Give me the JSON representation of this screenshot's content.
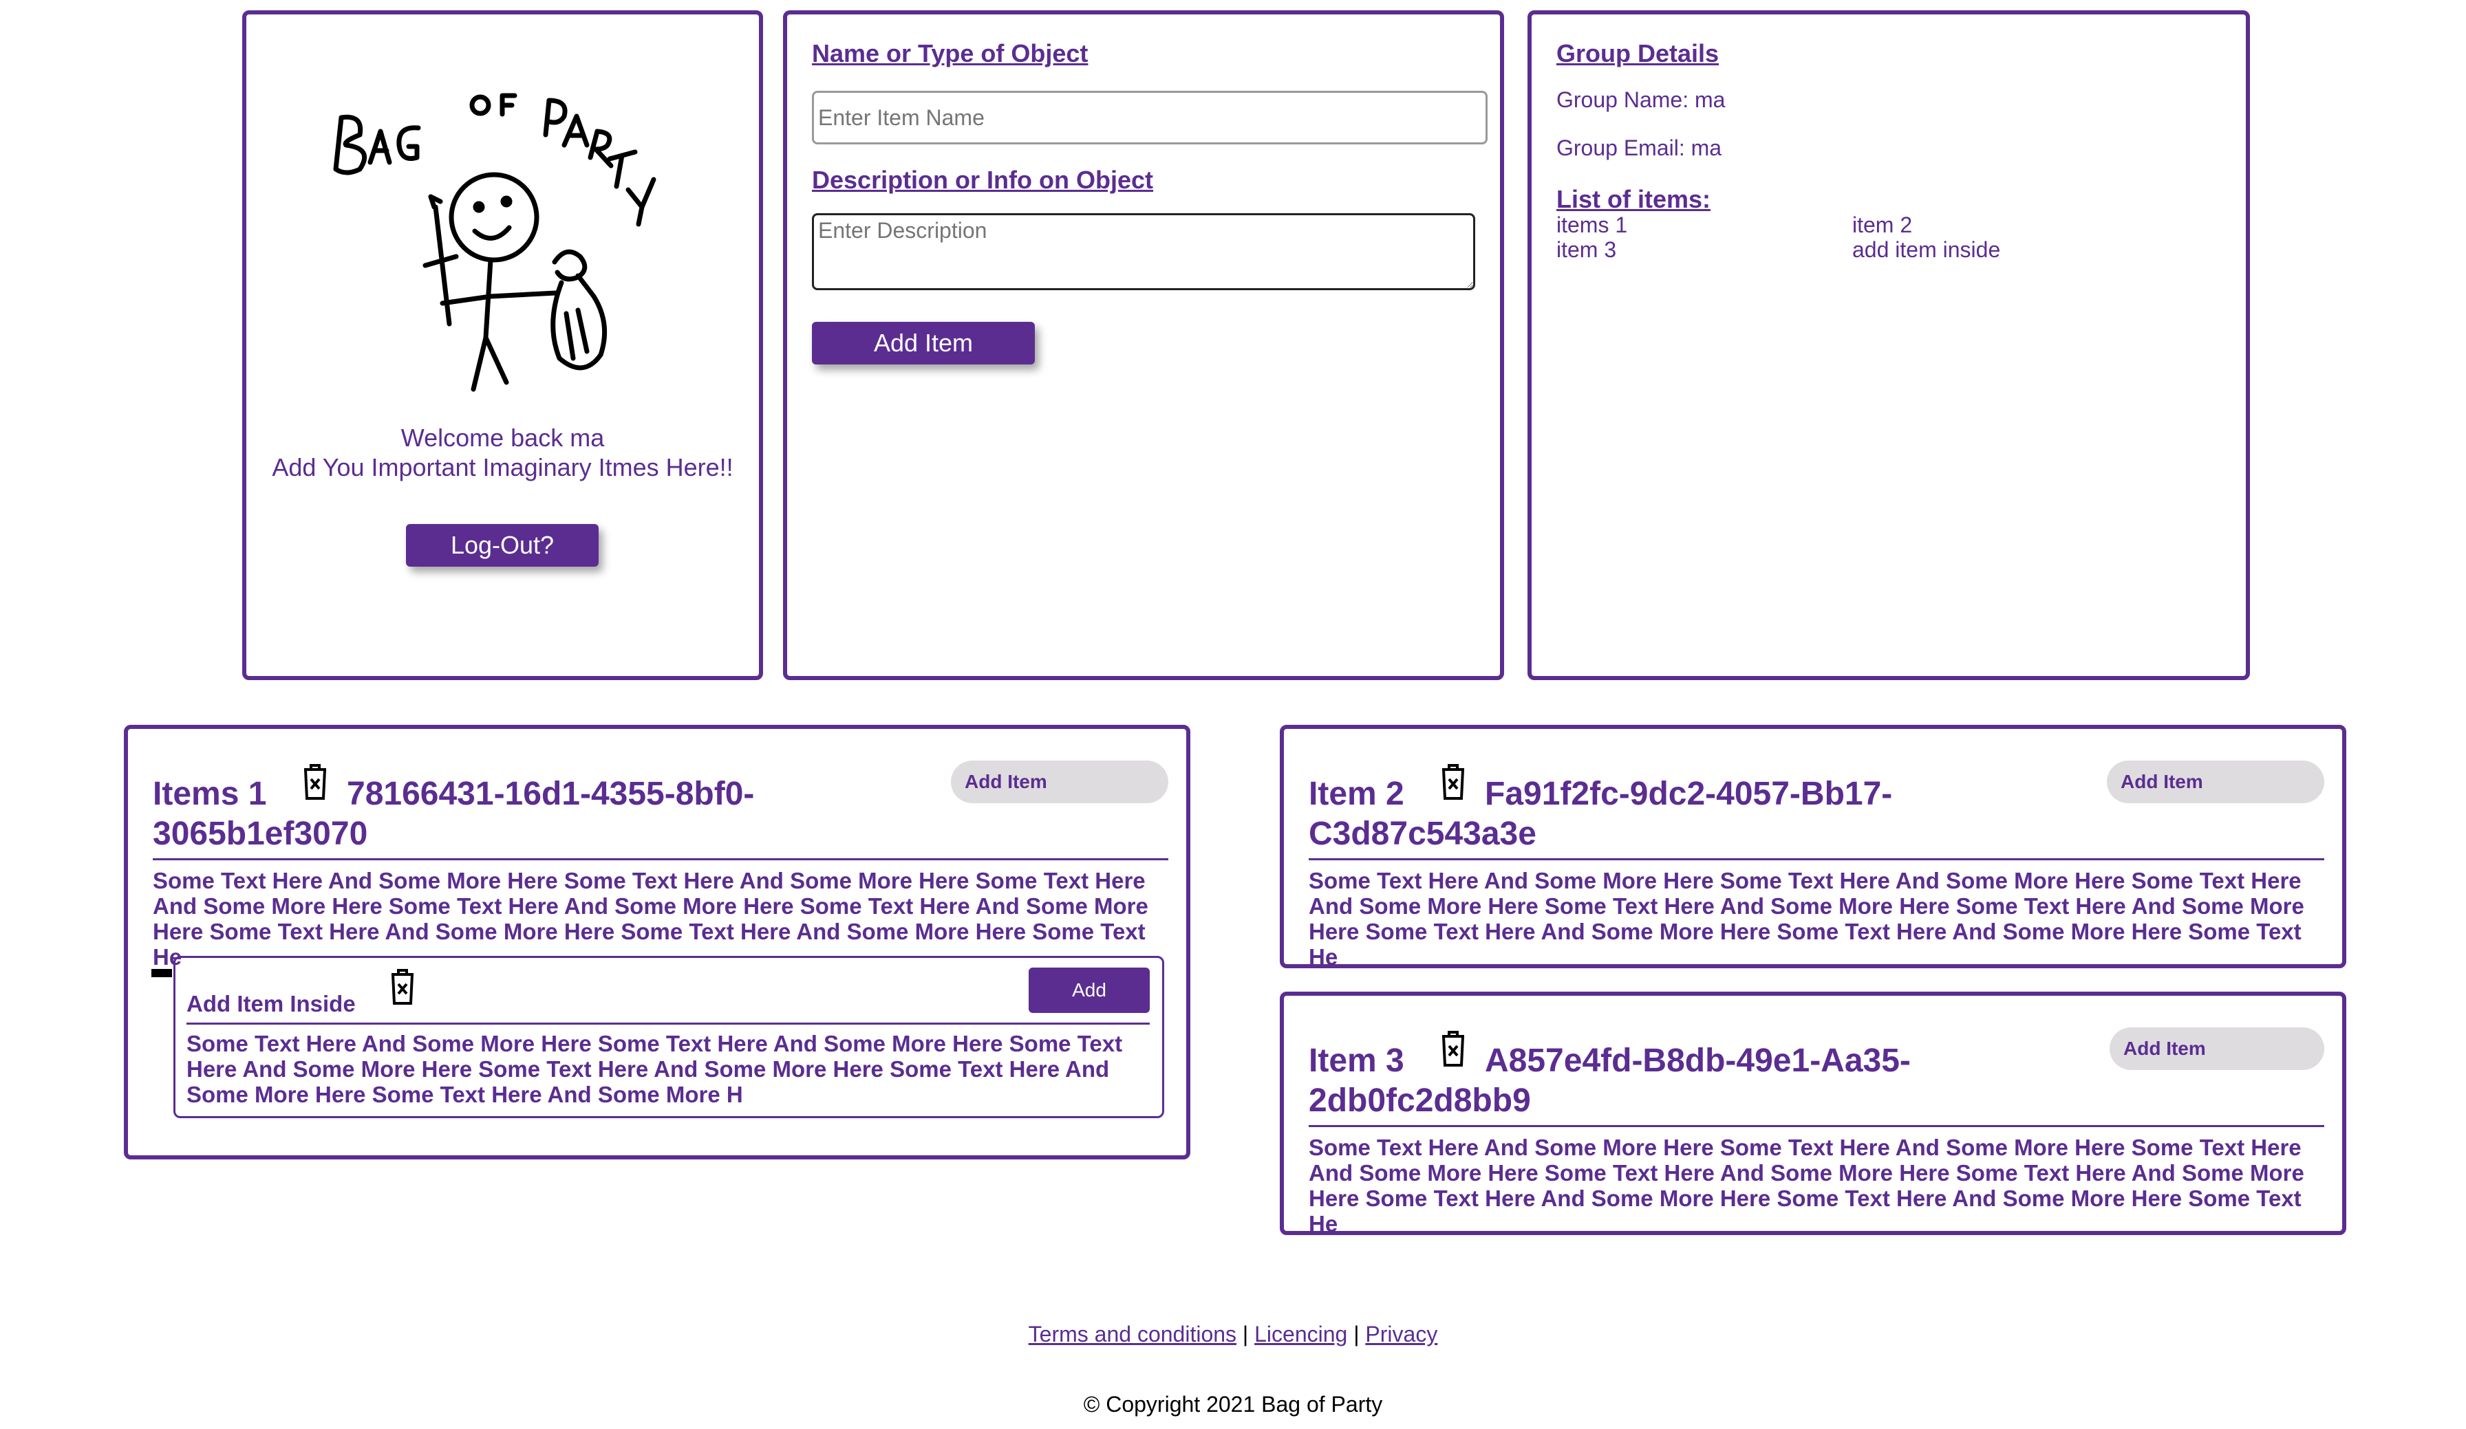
{
  "profile": {
    "logo_text": "Bag of Party",
    "welcome": "Welcome back ma",
    "tagline": "Add You Important Imaginary Itmes Here!!",
    "logout_label": "Log-Out?"
  },
  "add_form": {
    "name_heading": "Name or Type of Object",
    "name_placeholder": "Enter Item Name",
    "desc_heading": "Description or Info on Object",
    "desc_placeholder": "Enter Description",
    "submit_label": "Add Item"
  },
  "group": {
    "heading": "Group Details",
    "name_line": "Group Name: ma",
    "email_line": "Group Email: ma",
    "list_heading": "List of items:",
    "list_items": [
      "items 1",
      "item 2",
      "item 3",
      "add item inside"
    ]
  },
  "cards": [
    {
      "title_line1": "Items 1",
      "id_line1": "78166431-16d1-4355-8bf0-",
      "id_line2": "3065b1ef3070",
      "add_label": "Add Item",
      "text": [
        "Some Text Here And Some More Here Some Text Here And Some More Here Some Text Here",
        "And Some More Here Some Text Here And Some More Here Some Text Here And Some More",
        "Here Some Text Here And Some More Here Some Text Here And Some More Here Some Text He"
      ],
      "inside": {
        "title": "Add Item Inside",
        "add_label": "Add",
        "text": [
          "Some Text Here And Some More Here Some Text Here And Some More Here Some Text",
          "Here And Some More Here Some Text Here And Some More Here Some Text Here And",
          "Some More Here Some Text Here And Some More H"
        ]
      }
    },
    {
      "title_line1": "Item 2",
      "id_line1": "Fa91f2fc-9dc2-4057-Bb17-",
      "id_line2": "C3d87c543a3e",
      "add_label": "Add Item",
      "text": [
        "Some Text Here And Some More Here Some Text Here And Some More Here Some Text Here",
        "And Some More Here Some Text Here And Some More Here Some Text Here And Some More",
        "Here Some Text Here And Some More Here Some Text Here And Some More Here Some Text He"
      ]
    },
    {
      "title_line1": "Item 3",
      "id_line1": "A857e4fd-B8db-49e1-Aa35-",
      "id_line2": "2db0fc2d8bb9",
      "add_label": "Add Item",
      "text": [
        "Some Text Here And Some More Here Some Text Here And Some More Here Some Text Here",
        "And Some More Here Some Text Here And Some More Here Some Text Here And Some More",
        "Here Some Text Here And Some More Here Some Text Here And Some More Here Some Text He"
      ]
    }
  ],
  "footer": {
    "terms": "Terms and conditions",
    "licencing": "Licencing",
    "privacy": "Privacy",
    "separator": "|",
    "copyright": "© Copyright 2021 Bag of Party"
  },
  "colors": {
    "accent": "#5b2d91",
    "pill_bg": "#dedcdf"
  },
  "icons": [
    "trash-icon",
    "collapse-dash-icon",
    "bag-of-party-logo"
  ]
}
